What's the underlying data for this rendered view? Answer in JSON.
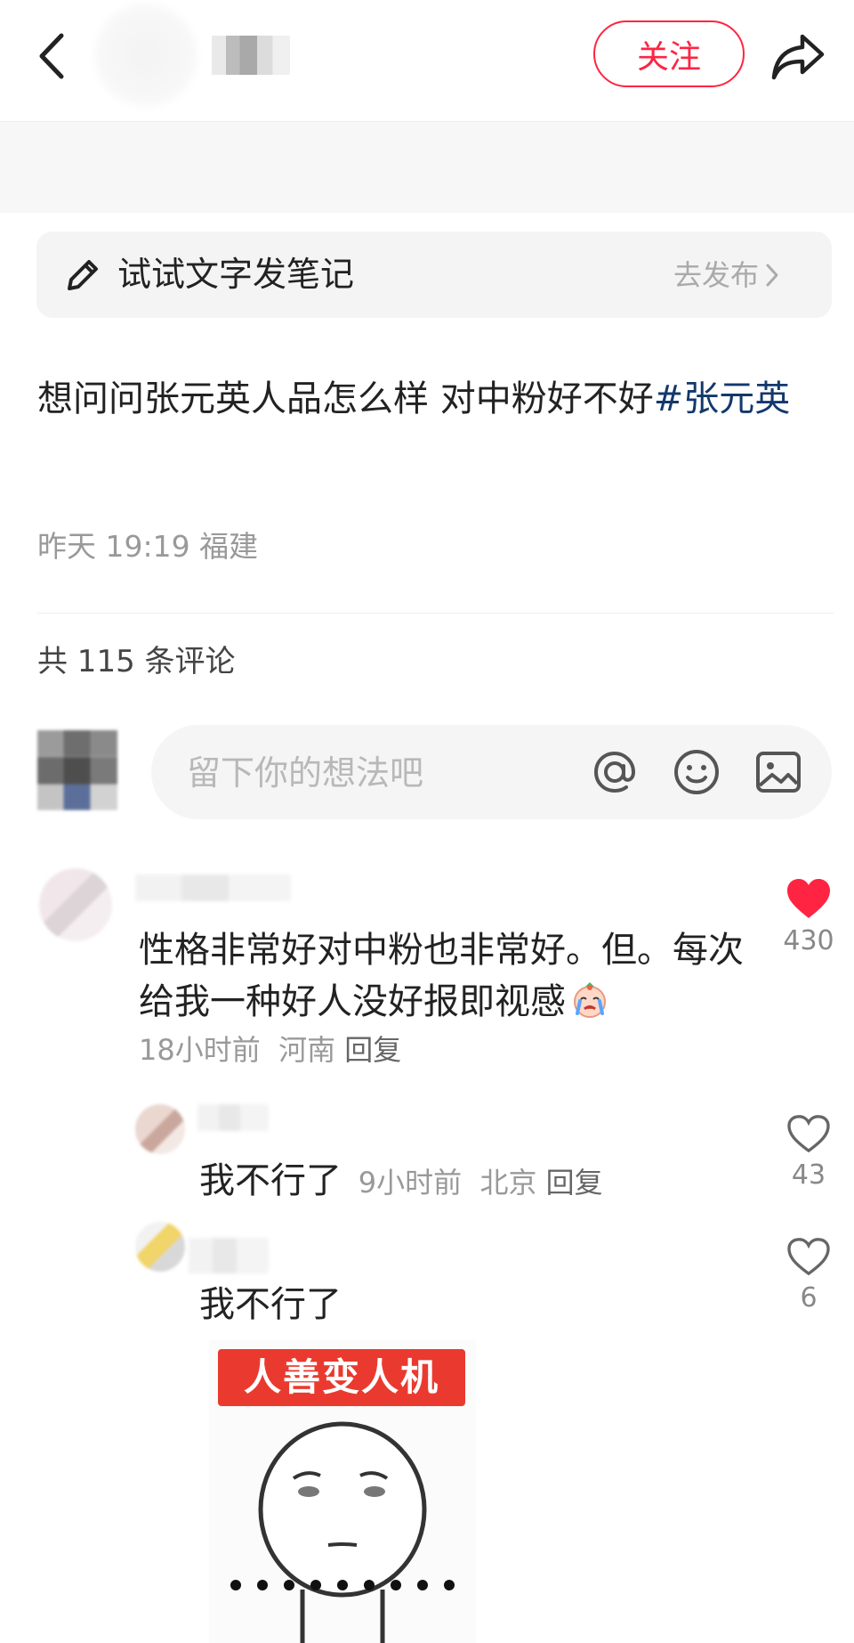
{
  "header": {
    "follow_label": "关注",
    "icons": {
      "back": "chevron-left-icon",
      "share": "share-arrow-icon"
    }
  },
  "note_bar": {
    "text": "试试文字发笔记",
    "action": "去发布",
    "icons": {
      "pencil": "pencil-icon",
      "chevron": "chevron-right-icon"
    }
  },
  "post": {
    "text": "想问问张元英人品怎么样 对中粉好不好",
    "hashtag": "#张元英",
    "meta": "昨天 19:19 福建"
  },
  "comments_header": {
    "count_text": "共 115 条评论"
  },
  "comment_input": {
    "placeholder": "留下你的想法吧",
    "icons": [
      "at-icon",
      "emoji-smile-icon",
      "image-icon"
    ]
  },
  "comments": [
    {
      "text": "性格非常好对中粉也非常好。但。每次给我一种好人没好报即视感",
      "time": "18小时前",
      "location": "河南",
      "reply_label": "回复",
      "likes": "430",
      "liked": true
    }
  ],
  "replies": [
    {
      "text": "我不行了",
      "time": "9小时前",
      "location": "北京",
      "reply_label": "回复",
      "likes": "43"
    },
    {
      "text": "我不行了",
      "likes": "6",
      "meme_text": "人善变人机"
    }
  ],
  "colors": {
    "accent": "#ff2442",
    "hashtag": "#13386c",
    "meme_label_bg": "#ea3a2f"
  }
}
